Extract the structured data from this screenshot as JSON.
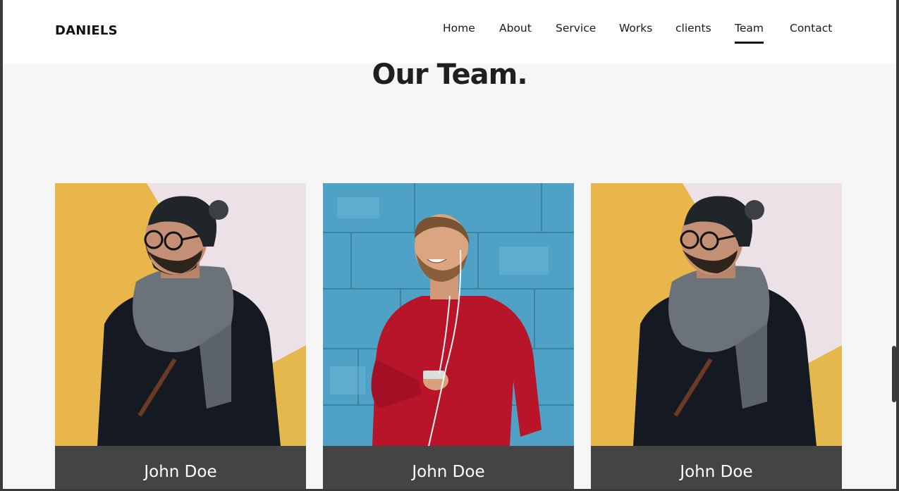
{
  "header": {
    "brand": "DANIELS",
    "nav": [
      {
        "label": "Home"
      },
      {
        "label": "About"
      },
      {
        "label": "Service"
      },
      {
        "label": "Works"
      },
      {
        "label": "clients"
      },
      {
        "label": "Team",
        "active": true
      },
      {
        "label": "Contact"
      }
    ]
  },
  "team": {
    "title": "Our Team.",
    "members": [
      {
        "name": "John Doe",
        "photo": "man-with-beanie-and-scarf"
      },
      {
        "name": "John Doe",
        "photo": "man-in-red-sweater-with-earphones"
      },
      {
        "name": "John Doe",
        "photo": "man-with-beanie-and-scarf"
      }
    ]
  },
  "colors": {
    "header_bg": "#ffffff",
    "page_bg": "#f6f6f6",
    "caption_bg": "#444444",
    "text_dark": "#1f1f22"
  }
}
